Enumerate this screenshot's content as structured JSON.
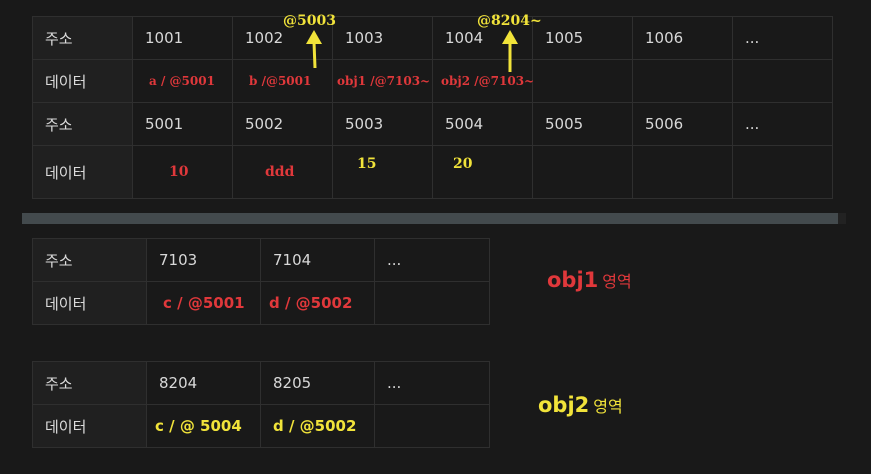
{
  "memory_table": {
    "rows": [
      {
        "header": "주소",
        "cells": [
          "1001",
          "1002",
          "1003",
          "1004",
          "1005",
          "1006",
          "..."
        ]
      },
      {
        "header": "데이터",
        "cells": [
          "a / @5001",
          "b  /@5001",
          "obj1 /@7103~",
          "obj2 /@7103~",
          "",
          "",
          ""
        ]
      },
      {
        "header": "주소",
        "cells": [
          "5001",
          "5002",
          "5003",
          "5004",
          "5005",
          "5006",
          "..."
        ]
      },
      {
        "header": "데이터",
        "cells": [
          "10",
          "ddd",
          "15",
          "20",
          "",
          "",
          ""
        ]
      }
    ]
  },
  "annotations": {
    "arrow1_label": "@5003",
    "arrow2_label": "@8204~"
  },
  "obj1_table": {
    "rows": [
      {
        "header": "주소",
        "cells": [
          "7103",
          "7104",
          "..."
        ]
      },
      {
        "header": "데이터",
        "cells": [
          "c / @5001",
          "d / @5002",
          ""
        ]
      }
    ]
  },
  "obj2_table": {
    "rows": [
      {
        "header": "주소",
        "cells": [
          "8204",
          "8205",
          "..."
        ]
      },
      {
        "header": "데이터",
        "cells": [
          "c  / @ 5004",
          "d / @5002",
          ""
        ]
      }
    ]
  },
  "regions": {
    "obj1_name": "obj1",
    "obj1_suffix": "영역",
    "obj2_name": "obj2",
    "obj2_suffix": "영역"
  },
  "colors": {
    "background": "#191919",
    "red": "#e0383b",
    "yellow": "#f1e33a",
    "divider": "#434a4d"
  }
}
